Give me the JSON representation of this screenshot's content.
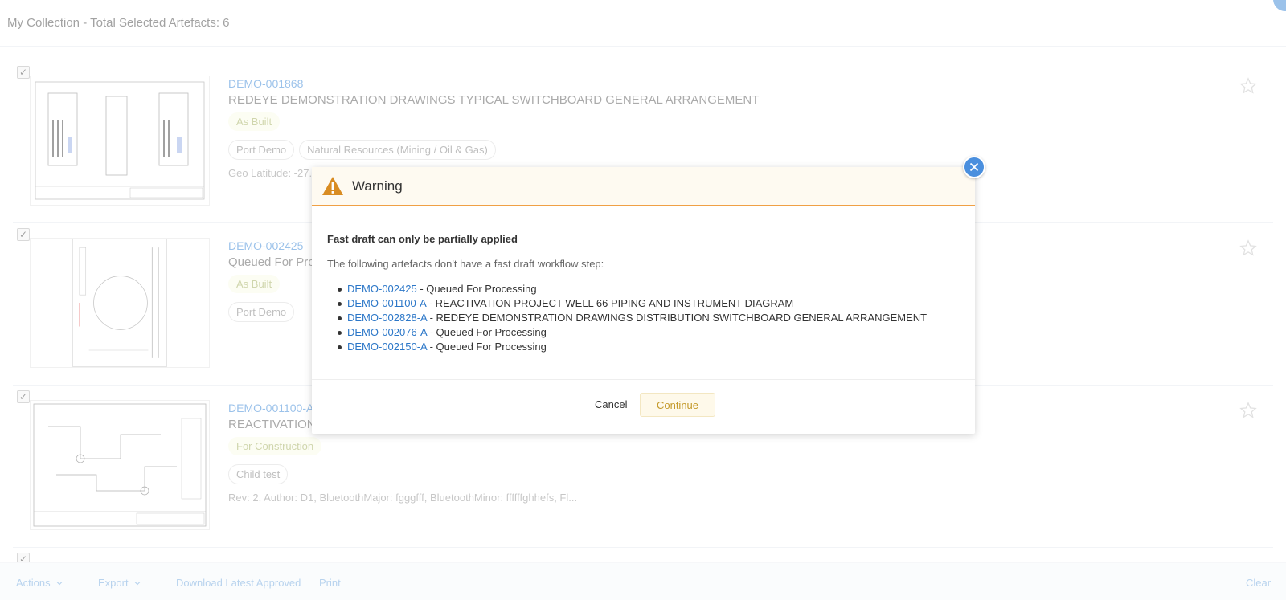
{
  "header": {
    "title": "My Collection - Total Selected Artefacts: 6"
  },
  "artefacts": [
    {
      "id": "DEMO-001868",
      "title": "REDEYE DEMONSTRATION DRAWINGS TYPICAL SWITCHBOARD GENERAL ARRANGEMENT",
      "status": "As Built",
      "tags": [
        "Port Demo",
        "Natural Resources (Mining / Oil & Gas)"
      ],
      "meta": "Geo Latitude: -27."
    },
    {
      "id": "DEMO-002425",
      "title": "Queued For Pro",
      "status": "As Built",
      "tags": [
        "Port Demo"
      ],
      "meta": ""
    },
    {
      "id": "DEMO-001100-A",
      "title": "REACTIVATION",
      "status": "For Construction",
      "tags": [
        "Child test"
      ],
      "meta": "Rev: 2, Author: D1, BluetoothMajor: fgggfff, BluetoothMinor: ffffffghhefs, Fl..."
    }
  ],
  "modal": {
    "title": "Warning",
    "heading": "Fast draft can only be partially applied",
    "description": "The following artefacts don't have a fast draft workflow step:",
    "items": [
      {
        "id": "DEMO-002425",
        "name": " - Queued For Processing"
      },
      {
        "id": "DEMO-001100-A",
        "name": " - REACTIVATION PROJECT WELL 66 PIPING AND INSTRUMENT DIAGRAM"
      },
      {
        "id": "DEMO-002828-A",
        "name": " - REDEYE DEMONSTRATION DRAWINGS DISTRIBUTION SWITCHBOARD GENERAL ARRANGEMENT"
      },
      {
        "id": "DEMO-002076-A",
        "name": " - Queued For Processing"
      },
      {
        "id": "DEMO-002150-A",
        "name": " - Queued For Processing"
      }
    ],
    "cancel_label": "Cancel",
    "continue_label": "Continue"
  },
  "bottom_bar": {
    "actions_label": "Actions",
    "export_label": "Export",
    "download_label": "Download Latest Approved",
    "print_label": "Print",
    "clear_label": "Clear"
  },
  "colors": {
    "accent": "#4a90d9",
    "warning": "#f0a045",
    "link": "#2c77c8",
    "status_green": "#a9b56a"
  }
}
